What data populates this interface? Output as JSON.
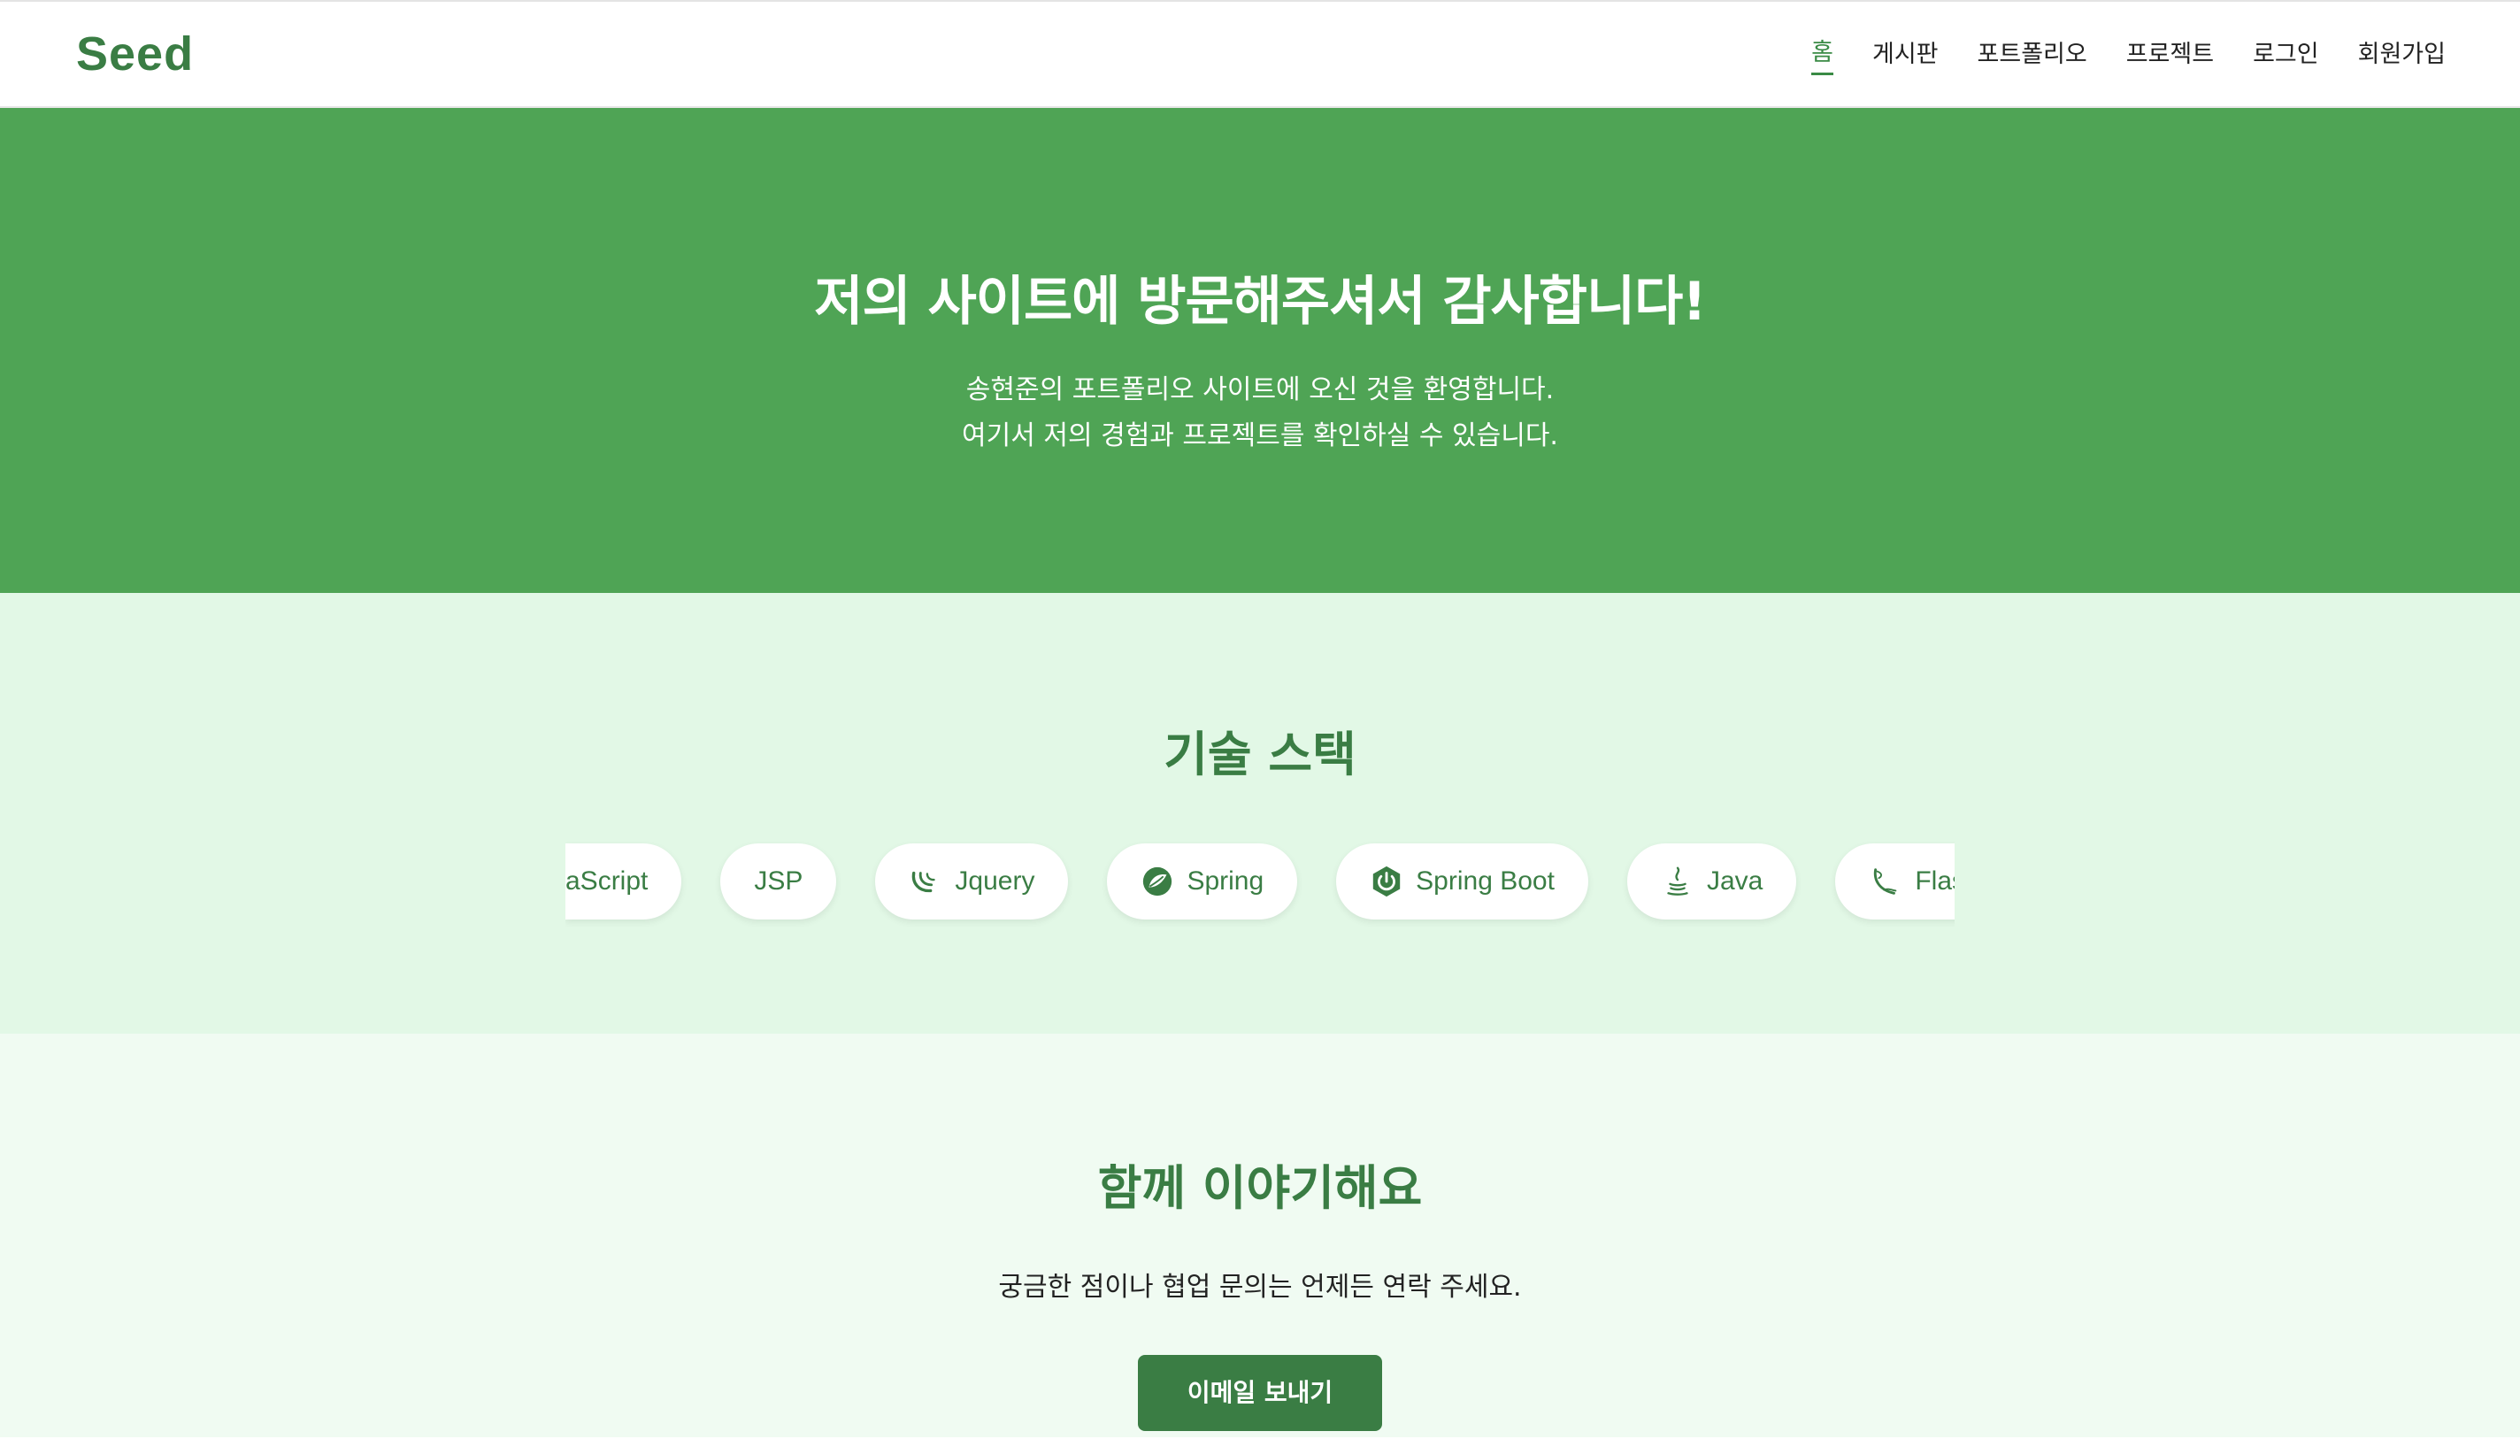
{
  "header": {
    "logo": "Seed",
    "nav": [
      {
        "label": "홈",
        "active": true
      },
      {
        "label": "게시판"
      },
      {
        "label": "포트폴리오"
      },
      {
        "label": "프로젝트"
      },
      {
        "label": "로그인"
      },
      {
        "label": "회원가입"
      }
    ]
  },
  "hero": {
    "title": "저의 사이트에 방문해주셔서 감사합니다!",
    "line1": "송현준의 포트폴리오 사이트에 오신 것을 환영합니다.",
    "line2": "여기서 저의 경험과 프로젝트를 확인하실 수 있습니다."
  },
  "skills": {
    "title": "기술 스택",
    "items": [
      {
        "label": "aScript",
        "icon": ""
      },
      {
        "label": "JSP",
        "icon": ""
      },
      {
        "label": "Jquery",
        "icon": "jquery-icon"
      },
      {
        "label": "Spring",
        "icon": "spring-icon"
      },
      {
        "label": "Spring Boot",
        "icon": "spring-boot-icon"
      },
      {
        "label": "Java",
        "icon": "java-icon"
      },
      {
        "label": "Flask",
        "icon": "flask-icon"
      }
    ]
  },
  "contact": {
    "title": "함께 이야기해요",
    "text": "궁금한 점이나 협업 문의는 언제든 연락 주세요.",
    "button": "이메일 보내기"
  },
  "colors": {
    "primary": "#3a7d44",
    "hero_bg": "#4fa455",
    "skills_bg": "#e2f8e6",
    "contact_bg": "#f0fbf2"
  }
}
